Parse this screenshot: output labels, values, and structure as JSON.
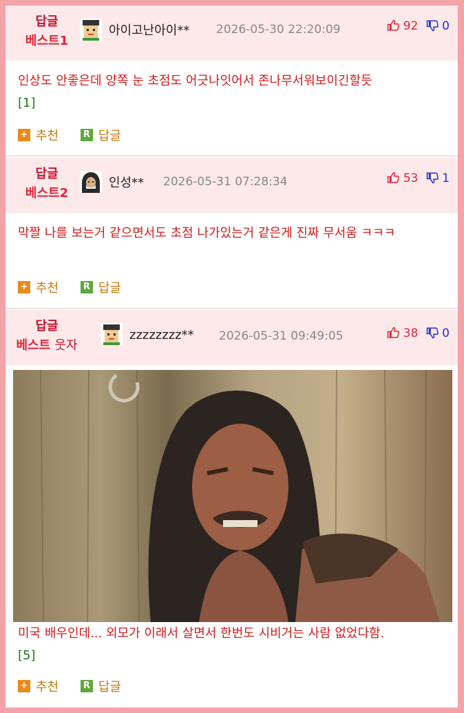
{
  "comments": [
    {
      "badge_top": "답글",
      "badge_bottom": "베스트1",
      "username": "아이고난아이**",
      "date": "2026-05-30 22:20:09",
      "up": "92",
      "down": "0",
      "text": "인상도 안좋은데 양쪽 눈 초점도 어긋나잇어서 존나무서워보이긴할듯",
      "ref": "[1]",
      "recommend_label": "추천",
      "reply_label": "답글",
      "avatar": "pixel-face-icon"
    },
    {
      "badge_top": "답글",
      "badge_bottom": "베스트2",
      "username": "인성**",
      "date": "2026-05-31 07:28:34",
      "up": "53",
      "down": "1",
      "text": "막짤 나를 보는거 같으면서도 초점 나가있는거 같은게 진짜 무서움 ㅋㅋㅋ",
      "recommend_label": "추천",
      "reply_label": "답글",
      "avatar": "hooded-figure-icon"
    },
    {
      "badge_top": "답글",
      "badge_bottom": "베스트",
      "badge_tag": "웃자",
      "username": "zzzzzzzz**",
      "date": "2026-05-31 09:49:05",
      "up": "38",
      "down": "0",
      "text": "미국 배우인데... 외모가 이래서 살면서 한번도 시비거는 사람 없었다함.",
      "ref": "[5]",
      "recommend_label": "추천",
      "reply_label": "답글",
      "avatar": "pixel-face-icon"
    }
  ],
  "colors": {
    "frame": "#f4a3a8",
    "header_bg": "#fde9ea",
    "text_red": "#d01c1c",
    "up": "#e0243c",
    "down": "#2233cc",
    "ref_green": "#1c7a1c",
    "action_orange": "#c47a10"
  }
}
